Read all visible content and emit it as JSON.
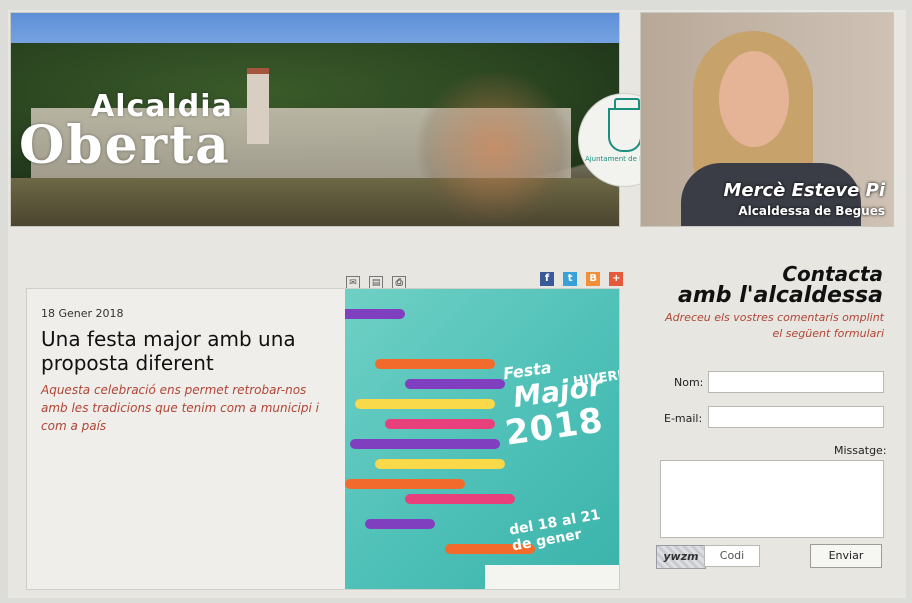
{
  "banner": {
    "title_small": "Alcaldia",
    "title_big": "Oberta",
    "seal_caption": "Ajuntament de Begues"
  },
  "mayor": {
    "name": "Mercè Esteve Pi",
    "role": "Alcaldessa de Begues"
  },
  "article": {
    "date": "18 Gener 2018",
    "title": "Una festa major amb una proposta diferent",
    "lead": "Aquesta celebració ens permet retrobar-nos amb les tradicions que tenim com a municipi i com a país",
    "tool_icons": [
      "email-icon",
      "pdf-icon",
      "print-icon"
    ],
    "share_icons": [
      "facebook-icon",
      "twitter-icon",
      "blogger-icon",
      "plus-icon"
    ],
    "poster": {
      "line1": "Festa",
      "line2": "Major",
      "line3": "HIVERN",
      "year": "2018",
      "dates": "del 18 al 21 de gener"
    }
  },
  "contact": {
    "title_line1": "Contacta",
    "title_line2": "amb l'alcaldessa",
    "subtitle": "Adreceu els vostres comentaris omplint el següent formulari",
    "name_label": "Nom:",
    "email_label": "E-mail:",
    "message_label": "Missatge:",
    "captcha_text": "ywzm",
    "code_placeholder": "Codi",
    "send_label": "Enviar"
  },
  "colors": {
    "accent_red": "#b04536",
    "seal_teal": "#1b8f7e",
    "poster_teal": "#4ec0b7"
  }
}
